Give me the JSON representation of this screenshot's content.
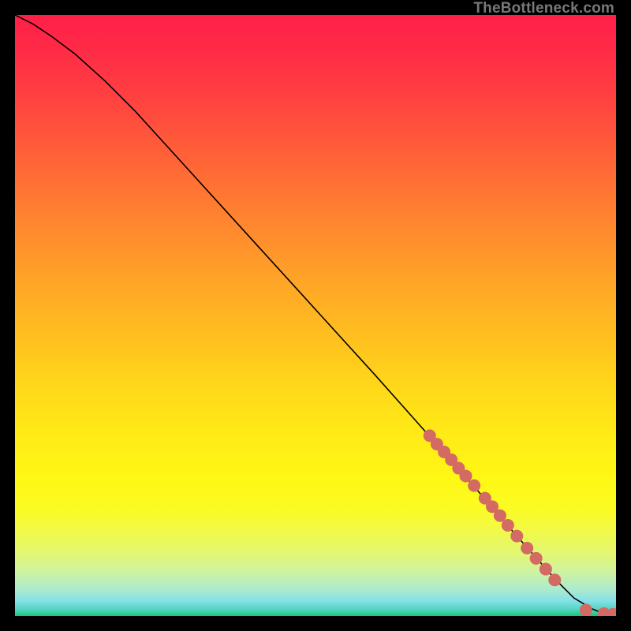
{
  "watermark": "TheBottleneck.com",
  "chart_data": {
    "type": "line",
    "title": "",
    "xlabel": "",
    "ylabel": "",
    "xlim": [
      0,
      100
    ],
    "ylim": [
      0,
      100
    ],
    "grid": false,
    "series": [
      {
        "name": "curve",
        "x": [
          0,
          3,
          6,
          10,
          15,
          20,
          30,
          40,
          50,
          60,
          68,
          76,
          82,
          86,
          90,
          93,
          96,
          98,
          100
        ],
        "y": [
          100,
          98.5,
          96.5,
          93.5,
          89,
          84,
          73,
          62,
          51,
          40,
          31,
          22,
          15,
          10.5,
          6,
          3,
          1.2,
          0.4,
          0.2
        ]
      }
    ],
    "markers": [
      {
        "x": 69.0,
        "y": 30.0
      },
      {
        "x": 70.2,
        "y": 28.6
      },
      {
        "x": 71.4,
        "y": 27.3
      },
      {
        "x": 72.6,
        "y": 26.0
      },
      {
        "x": 73.8,
        "y": 24.6
      },
      {
        "x": 75.0,
        "y": 23.3
      },
      {
        "x": 76.4,
        "y": 21.7
      },
      {
        "x": 78.2,
        "y": 19.6
      },
      {
        "x": 79.4,
        "y": 18.2
      },
      {
        "x": 80.7,
        "y": 16.7
      },
      {
        "x": 82.0,
        "y": 15.1
      },
      {
        "x": 83.5,
        "y": 13.3
      },
      {
        "x": 85.2,
        "y": 11.3
      },
      {
        "x": 86.7,
        "y": 9.6
      },
      {
        "x": 88.3,
        "y": 7.8
      },
      {
        "x": 89.8,
        "y": 6.0
      },
      {
        "x": 95.0,
        "y": 1.0
      },
      {
        "x": 98.0,
        "y": 0.4
      },
      {
        "x": 99.5,
        "y": 0.3
      }
    ],
    "marker_style": {
      "color": "#d36a63",
      "radius": 8
    },
    "line_style": {
      "color": "#000000",
      "width": 1.6
    }
  }
}
